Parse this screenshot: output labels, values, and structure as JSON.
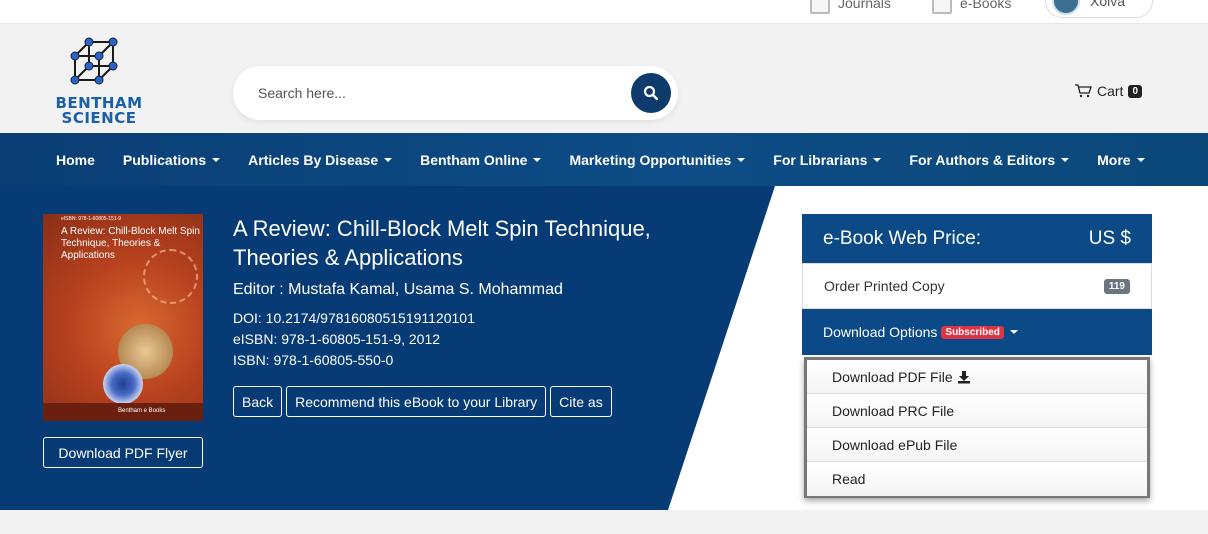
{
  "topbar": {
    "journals_label": "Journals",
    "ebooks_label": "e-Books",
    "account_name": "Xolva"
  },
  "logo": {
    "line1": "BENTHAM",
    "line2": "SCIENCE"
  },
  "search": {
    "placeholder": "Search here..."
  },
  "cart": {
    "label": "Cart",
    "count": "0"
  },
  "nav": {
    "items": [
      {
        "label": "Home"
      },
      {
        "label": "Publications"
      },
      {
        "label": "Articles By Disease"
      },
      {
        "label": "Bentham Online"
      },
      {
        "label": "Marketing Opportunities"
      },
      {
        "label": "For Librarians"
      },
      {
        "label": "For Authors & Editors"
      },
      {
        "label": "More"
      }
    ]
  },
  "book": {
    "cover_isbn": "eISBN: 978-1-60805-151-9",
    "cover_title": "A Review: Chill-Block Melt Spin Technique, Theories & Applications",
    "cover_publisher": "Bentham e Books",
    "title": "A Review: Chill-Block Melt Spin Technique, Theories & Applications",
    "editor": "Editor : Mustafa Kamal, Usama S. Mohammad",
    "doi": "DOI: 10.2174/97816080515191120101",
    "eisbn": "eISBN: 978-1-60805-151-9, 2012",
    "isbn": "ISBN: 978-1-60805-550-0",
    "flyer_button": "Download PDF Flyer",
    "back_button": "Back",
    "recommend_button": "Recommend this eBook to your Library",
    "cite_button": "Cite as"
  },
  "pricing": {
    "heading": "e-Book Web Price:",
    "currency": "US $",
    "order_label": "Order Printed Copy",
    "order_price": "119",
    "download_label": "Download Options",
    "subscribed_badge": "Subscribed",
    "options": [
      {
        "label": "Download PDF File"
      },
      {
        "label": "Download PRC File"
      },
      {
        "label": "Download ePub File"
      },
      {
        "label": "Read"
      }
    ]
  },
  "colors": {
    "primary": "#063b75",
    "nav": "#0a3e74",
    "panel": "#0b4a86",
    "badge_red": "#dc3545"
  }
}
